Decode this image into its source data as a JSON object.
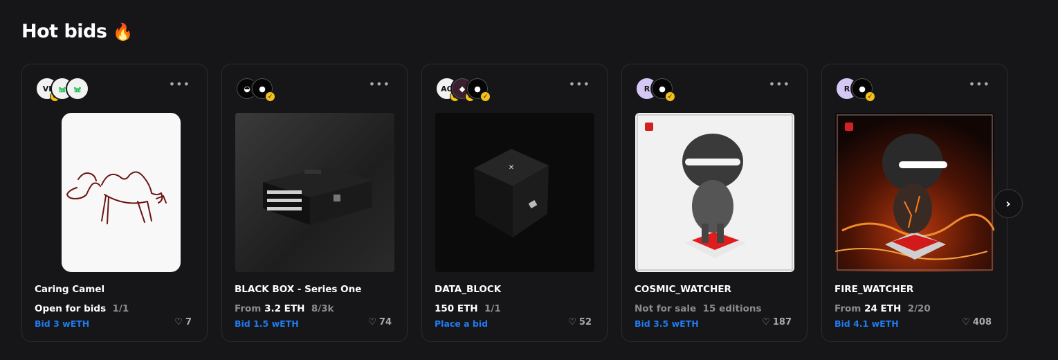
{
  "section": {
    "title": "Hot bids",
    "icon": "flame-icon"
  },
  "cards": [
    {
      "title": "Caring Camel",
      "price_prefix": "",
      "price": "Open for bids",
      "edition": "1/1",
      "bid": "Bid 3 wETH",
      "likes": "7",
      "avatars": [
        {
          "label": "VI"
        },
        {
          "label": "𖠌"
        },
        {
          "label": "𖠌"
        }
      ]
    },
    {
      "title": "BLACK BOX - Series One",
      "price_prefix": "From",
      "price": "3.2 ETH",
      "edition": "8/3k",
      "bid": "Bid 1.5 wETH",
      "likes": "74",
      "avatars": [
        {
          "label": ""
        },
        {
          "label": ""
        }
      ]
    },
    {
      "title": "DATA_BLOCK",
      "price_prefix": "",
      "price": "150 ETH",
      "edition": "1/1",
      "bid": "Place a bid",
      "likes": "52",
      "avatars": [
        {
          "label": "AO"
        },
        {
          "label": ""
        },
        {
          "label": ""
        }
      ]
    },
    {
      "title": "COSMIC_WATCHER",
      "price_prefix": "",
      "price": "Not for sale",
      "edition": "15 editions",
      "bid": "Bid 3.5 wETH",
      "likes": "187",
      "avatars": [
        {
          "label": "R"
        },
        {
          "label": ""
        }
      ]
    },
    {
      "title": "FIRE_WATCHER",
      "price_prefix": "From",
      "price": "24 ETH",
      "edition": "2/20",
      "bid": "Bid 4.1 wETH",
      "likes": "408",
      "avatars": [
        {
          "label": "R"
        },
        {
          "label": ""
        }
      ]
    }
  ],
  "nav": {
    "next_icon": "chevron-right-icon",
    "next_glyph": "›"
  },
  "colors": {
    "background": "#161618",
    "accent_blue": "#1f7bf2",
    "verified_gold": "#f3c01a"
  }
}
